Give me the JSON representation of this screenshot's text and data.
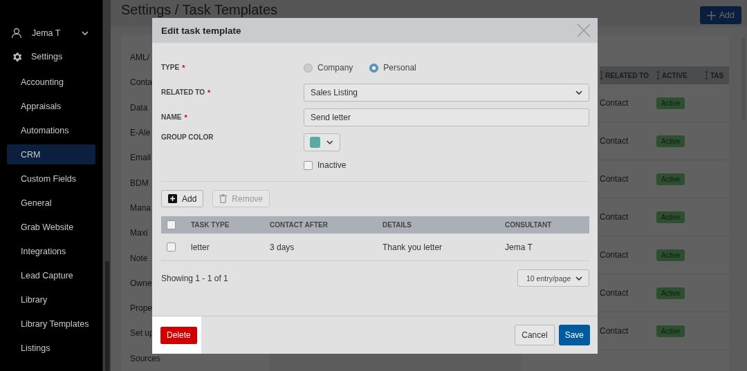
{
  "sidebar": {
    "user": "Jema T",
    "section": "Settings",
    "items": [
      {
        "label": "Accounting",
        "selected": false
      },
      {
        "label": "Appraisals",
        "selected": false
      },
      {
        "label": "Automations",
        "selected": false
      },
      {
        "label": "CRM",
        "selected": true
      },
      {
        "label": "Custom Fields",
        "selected": false
      },
      {
        "label": "General",
        "selected": false
      },
      {
        "label": "Grab Website",
        "selected": false
      },
      {
        "label": "Integrations",
        "selected": false
      },
      {
        "label": "Lead Capture",
        "selected": false
      },
      {
        "label": "Library",
        "selected": false
      },
      {
        "label": "Library Templates",
        "selected": false
      },
      {
        "label": "Listings",
        "selected": false
      }
    ]
  },
  "page": {
    "title": "Settings / Task Templates",
    "add_button": "Add"
  },
  "settings_list": [
    "AML/",
    "Conta",
    "Data",
    "E-Ale",
    "Email",
    "BDM",
    "Mana",
    "Maxi",
    "Note",
    "Owne",
    "Prope",
    "Set up",
    "Sources"
  ],
  "templates_table": {
    "columns": [
      "RELATED TO",
      "ACTIVE",
      "TAS"
    ],
    "rows": [
      {
        "related_to": "Contact",
        "status": "Active"
      },
      {
        "related_to": "Contact",
        "status": "Active"
      },
      {
        "related_to": "Contact",
        "status": "Active"
      },
      {
        "related_to": "Contact",
        "status": "Active"
      },
      {
        "related_to": "Contact",
        "status": "Active"
      },
      {
        "related_to": "Contact",
        "status": "Active"
      },
      {
        "related_to": "Contact",
        "status": "Active"
      }
    ]
  },
  "dialog": {
    "title": "Edit task template",
    "type": {
      "label": "TYPE",
      "required_mark": "*",
      "options": [
        {
          "label": "Company",
          "selected": false
        },
        {
          "label": "Personal",
          "selected": true
        }
      ]
    },
    "related_to": {
      "label": "RELATED TO",
      "required_mark": "*",
      "value": "Sales Listing"
    },
    "name": {
      "label": "NAME",
      "required_mark": "*",
      "value": "Send letter"
    },
    "group_color": {
      "label": "GROUP COLOR",
      "color": "#5aa9a3"
    },
    "inactive": {
      "label": "Inactive",
      "checked": false
    },
    "add_button": "Add",
    "remove_button": {
      "label": "Remove",
      "disabled": true
    },
    "tasks": {
      "all_checked": false,
      "columns": [
        "TASK TYPE",
        "CONTACT AFTER",
        "DETAILS",
        "CONSULTANT"
      ],
      "rows": [
        {
          "selected": false,
          "cells": [
            "letter",
            "3 days",
            "Thank you letter",
            "Jema T"
          ]
        }
      ]
    },
    "showing": "Showing 1 - 1 of 1",
    "page_size": "10 entry/page",
    "delete_button": "Delete",
    "cancel_button": "Cancel",
    "save_button": "Save"
  }
}
